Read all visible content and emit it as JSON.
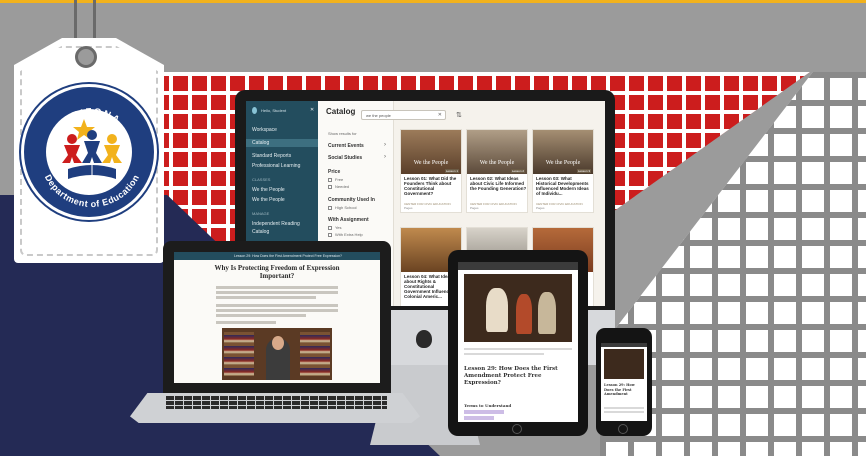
{
  "brand": {
    "logo_top": "ARIZONA",
    "logo_bottom": "Department of Education",
    "colors": {
      "gold": "#f2b21c",
      "red": "#cc1d1d",
      "navy": "#242a55",
      "seal_blue": "#1f3e7f",
      "teal": "#234d5e"
    }
  },
  "desktop_app": {
    "sidebar": {
      "user": "Hello, Student",
      "items": [
        "Workspace",
        "Catalog",
        "Standard Reports",
        "Professional Learning"
      ],
      "active_index": 1,
      "classes_header": "CLASSES",
      "classes": [
        "We the People",
        "We the People"
      ],
      "manage_header": "MANAGE",
      "manage": [
        "Independent Reading",
        "Catalog"
      ]
    },
    "catalog": {
      "title": "Catalog",
      "search_value": "we the people",
      "filter_header": "Show results for",
      "groups": [
        "Current Events",
        "Social Studies"
      ],
      "price_label": "Price",
      "price_options": [
        "Free",
        "Needed"
      ],
      "community_label": "Community Used In",
      "community_options": [
        "High School"
      ],
      "assign_label": "With Assignment",
      "assign_options": [
        "Yes",
        "With Extra Help"
      ]
    },
    "cards": [
      {
        "watermark": "We the People",
        "badge": "Lesson 1",
        "title": "Lesson 01: What Did the Founders Think about Constitutional Government?",
        "sub": "CENTER FOR CIVIC EDUCATION",
        "foot": "Pages"
      },
      {
        "watermark": "We the People",
        "badge": "Lesson 2",
        "title": "Lesson 02: What Ideas about Civic Life Informed the Founding Generation?",
        "sub": "CENTER FOR CIVIC EDUCATION",
        "foot": "Pages"
      },
      {
        "watermark": "We the People",
        "badge": "Lesson 3",
        "title": "Lesson 03: What Historical Developments Influenced Modern Ideas of Individu...",
        "sub": "CENTER FOR CIVIC EDUCATION",
        "foot": "Pages"
      },
      {
        "watermark": "",
        "badge": "",
        "title": "Lesson 04: What Ideas about Rights & Constitutional Government Influenced Colonial Americ...",
        "sub": "",
        "foot": ""
      }
    ]
  },
  "laptop_app": {
    "topbar": "Lesson 29: How Does the First Amendment Protect Free Expression?",
    "heading": "Why Is Protecting Freedom of Expression Important?"
  },
  "tablet_app": {
    "lesson": "Lesson 29: How Does the First Amendment Protect Free Expression?",
    "terms": "Terms to Understand"
  },
  "phone_app": {
    "lesson": "Lesson 29: How Does the First Amendment"
  }
}
